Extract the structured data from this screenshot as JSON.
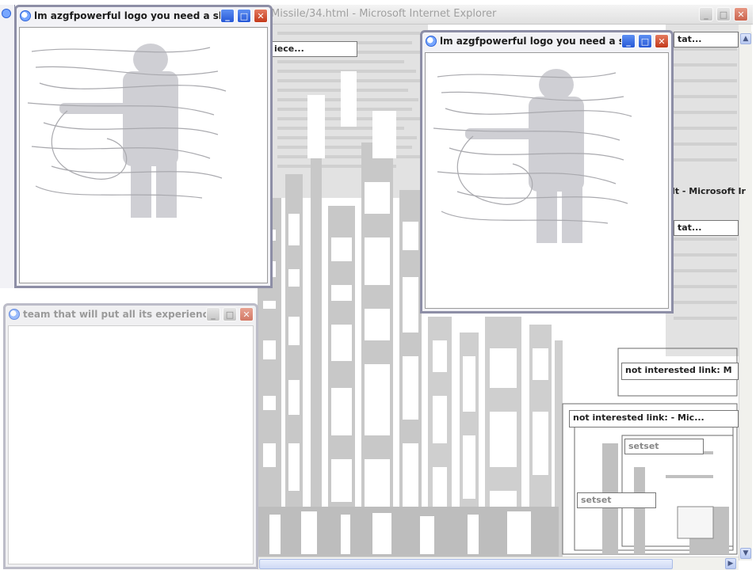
{
  "main_window": {
    "title": "Missile/34.html - Microsoft Internet Explorer"
  },
  "popups": [
    {
      "title": "lm azgfpowerful logo you need a ski..."
    },
    {
      "title": "lm azgfpowerful logo you need a ski..."
    },
    {
      "title": "team that will put all its experience..."
    }
  ],
  "fragments": {
    "piece_left": "iece...",
    "tab_right_top": "tat...",
    "microsoft_label": "lt - Microsoft Ir",
    "tab_right_mid": "tat...",
    "not_interested_1": "not interested link:  M",
    "not_interested_2": "not interested link: - Mic...",
    "setset_1": "setset",
    "setset_2": "setset"
  },
  "icons": {
    "ie": "ie-page-icon",
    "minimize": "minimize-icon",
    "maximize": "maximize-icon",
    "close": "close-icon"
  },
  "colors": {
    "title_blue": "#2557d6",
    "close_red": "#c3391b",
    "frame": "#8d8ea6",
    "glitch_grey": "#c8c8c8"
  }
}
